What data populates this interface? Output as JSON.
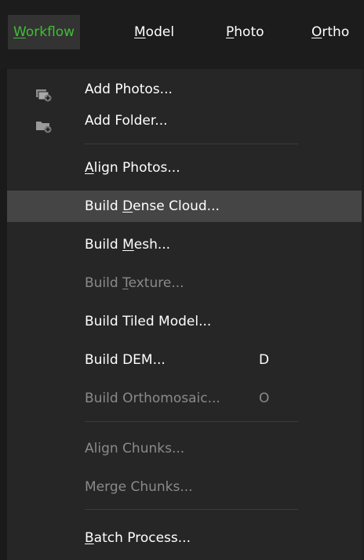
{
  "menubar": {
    "items": [
      {
        "label": "Workflow",
        "mnemonic": "W"
      },
      {
        "label": "Model",
        "mnemonic": "M"
      },
      {
        "label": "Photo",
        "mnemonic": "P"
      },
      {
        "label": "Ortho",
        "mnemonic": "O"
      }
    ]
  },
  "menu": {
    "items": [
      {
        "label": "Add Photos...",
        "icon": "add-photos-icon",
        "enabled": true
      },
      {
        "label": "Add Folder...",
        "icon": "add-folder-icon",
        "enabled": true
      },
      {
        "label": "Align Photos...",
        "mnemonic": "A",
        "enabled": true
      },
      {
        "label": "Build Dense Cloud...",
        "mnemonic": "D",
        "enabled": true,
        "highlighted": true
      },
      {
        "label": "Build Mesh...",
        "mnemonic": "M",
        "enabled": true
      },
      {
        "label": "Build Texture...",
        "mnemonic": "T",
        "enabled": false
      },
      {
        "label": "Build Tiled Model...",
        "enabled": true
      },
      {
        "label": "Build DEM...",
        "shortcut": "D",
        "enabled": true
      },
      {
        "label": "Build Orthomosaic...",
        "shortcut": "O",
        "enabled": false
      },
      {
        "label": "Align Chunks...",
        "enabled": false
      },
      {
        "label": "Merge Chunks...",
        "enabled": false
      },
      {
        "label": "Batch Process...",
        "mnemonic": "B",
        "enabled": true
      }
    ]
  },
  "colors": {
    "active_menu_text": "#3fbf32",
    "menu_background": "#262626",
    "highlight": "#454545",
    "disabled_text": "#8a8a8a"
  }
}
